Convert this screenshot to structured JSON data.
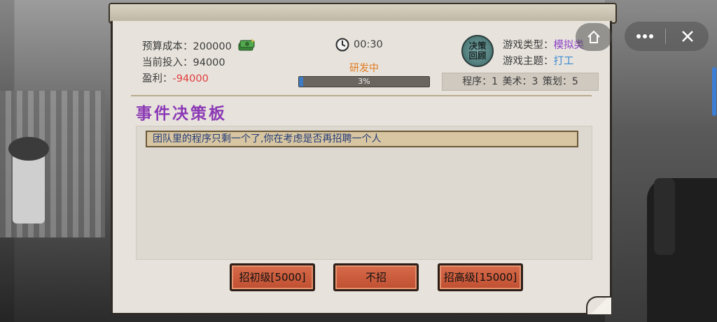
{
  "budget": {
    "label": "预算成本：",
    "value": "200000"
  },
  "investment": {
    "label": "当前投入：",
    "value": "94000"
  },
  "profit": {
    "label": "盈利：",
    "value": "-94000"
  },
  "timer": {
    "value": "00:30"
  },
  "status": {
    "text": "研发中"
  },
  "progress": {
    "percent": 3,
    "label": "3%"
  },
  "review_button": {
    "line1": "决策",
    "line2": "回顾"
  },
  "game_type": {
    "label": "游戏类型：",
    "value": "模拟类"
  },
  "game_theme": {
    "label": "游戏主题：",
    "value": "打工"
  },
  "team": {
    "text": "程序：1  美术：3  策划：5"
  },
  "board": {
    "title": "事件决策板",
    "message": "团队里的程序只剩一个了,你在考虑是否再招聘一个人"
  },
  "actions": {
    "hire_junior": "招初级[5000]",
    "no_hire": "不招",
    "hire_senior": "招高级[15000]"
  },
  "colors": {
    "progress_fill": "#3f7bc4",
    "profit_negative": "#e23c3c",
    "board_title": "#8c3ab5",
    "action_button": "#c85737"
  }
}
